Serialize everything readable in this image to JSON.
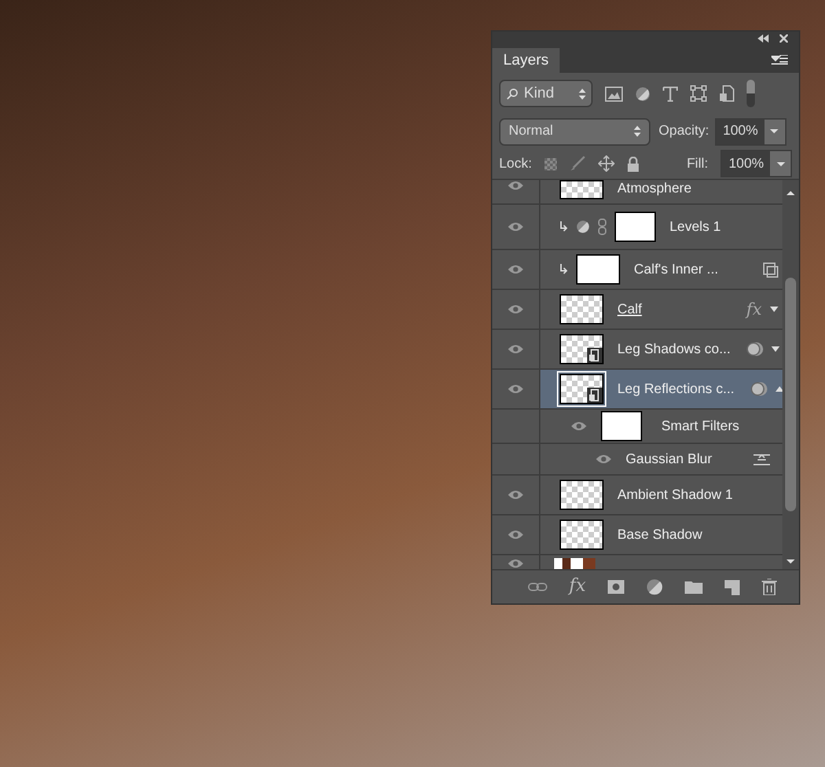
{
  "panel": {
    "tab": "Layers",
    "filter": "Kind",
    "blend_mode": "Normal",
    "opacity_label": "Opacity:",
    "opacity": "100%",
    "lock_label": "Lock:",
    "fill_label": "Fill:",
    "fill": "100%",
    "footer_fx": "fx"
  },
  "layers": [
    {
      "kind": "cut-top",
      "name": "Atmosphere",
      "visible": true,
      "selected": false
    },
    {
      "kind": "adjustment",
      "name": "Levels 1",
      "visible": true,
      "selected": false,
      "clipped": true
    },
    {
      "kind": "layer",
      "name": "Calf's Inner ...",
      "visible": true,
      "selected": false,
      "clipped": true,
      "white_thumb": true,
      "smart_badge": true
    },
    {
      "kind": "layer",
      "name": "Calf",
      "visible": true,
      "selected": false,
      "clip_base": true,
      "fx_label": "fx",
      "expandable": true
    },
    {
      "kind": "layer",
      "name": "Leg Shadows co...",
      "visible": true,
      "selected": false,
      "smart_object": true,
      "filter_badge": true,
      "expandable": true
    },
    {
      "kind": "layer",
      "name": "Leg Reflections c...",
      "visible": true,
      "selected": true,
      "smart_object": true,
      "filter_badge": true,
      "expandable": true
    },
    {
      "kind": "filters-header",
      "name": "Smart Filters",
      "visible": true,
      "selected": false
    },
    {
      "kind": "filter",
      "name": "Gaussian Blur",
      "visible": true,
      "selected": false
    },
    {
      "kind": "layer",
      "name": "Ambient Shadow 1",
      "visible": true,
      "selected": false
    },
    {
      "kind": "layer",
      "name": "Base Shadow",
      "visible": true,
      "selected": false
    },
    {
      "kind": "cut-bottom",
      "visible": true,
      "selected": false
    }
  ]
}
